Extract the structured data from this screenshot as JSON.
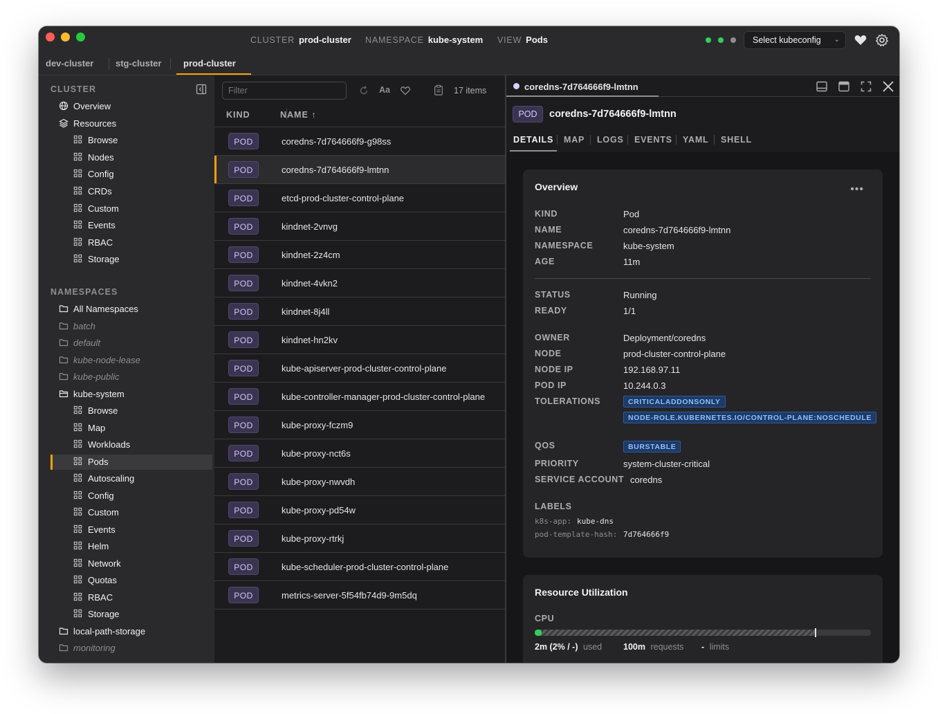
{
  "titlebar": {
    "cluster_key": "CLUSTER",
    "cluster_val": "prod-cluster",
    "namespace_key": "NAMESPACE",
    "namespace_val": "kube-system",
    "view_key": "VIEW",
    "view_val": "Pods",
    "status_dots": [
      "#30d158",
      "#30d158",
      "#8e8e93"
    ],
    "kubeconfig_label": "Select kubeconfig",
    "icons": [
      "heart-icon",
      "gear-icon"
    ]
  },
  "cluster_tabs": [
    "dev-cluster",
    "stg-cluster",
    "prod-cluster"
  ],
  "sidebar": {
    "cluster_header": "CLUSTER",
    "cluster_items": [
      {
        "label": "Overview",
        "icon": "globe-icon",
        "level": 0
      },
      {
        "label": "Resources",
        "icon": "layers-icon",
        "level": 0
      },
      {
        "label": "Browse",
        "icon": "grid-icon",
        "level": 1
      },
      {
        "label": "Nodes",
        "icon": "grid-icon",
        "level": 1
      },
      {
        "label": "Config",
        "icon": "grid-icon",
        "level": 1
      },
      {
        "label": "CRDs",
        "icon": "grid-icon",
        "level": 1
      },
      {
        "label": "Custom",
        "icon": "grid-icon",
        "level": 1
      },
      {
        "label": "Events",
        "icon": "grid-icon",
        "level": 1
      },
      {
        "label": "RBAC",
        "icon": "grid-icon",
        "level": 1
      },
      {
        "label": "Storage",
        "icon": "grid-icon",
        "level": 1
      }
    ],
    "namespaces_header": "NAMESPACES",
    "namespace_items": [
      {
        "label": "All Namespaces",
        "icon": "folder-icon",
        "level": 0
      },
      {
        "label": "batch",
        "icon": "folder-icon",
        "level": 0,
        "muted": true
      },
      {
        "label": "default",
        "icon": "folder-icon",
        "level": 0,
        "muted": true
      },
      {
        "label": "kube-node-lease",
        "icon": "folder-icon",
        "level": 0,
        "muted": true
      },
      {
        "label": "kube-public",
        "icon": "folder-icon",
        "level": 0,
        "muted": true
      },
      {
        "label": "kube-system",
        "icon": "folder-open-icon",
        "level": 0
      },
      {
        "label": "Browse",
        "icon": "grid-icon",
        "level": 1
      },
      {
        "label": "Map",
        "icon": "grid-icon",
        "level": 1
      },
      {
        "label": "Workloads",
        "icon": "grid-icon",
        "level": 1
      },
      {
        "label": "Pods",
        "icon": "grid-icon",
        "level": 1,
        "active": true
      },
      {
        "label": "Autoscaling",
        "icon": "grid-icon",
        "level": 1
      },
      {
        "label": "Config",
        "icon": "grid-icon",
        "level": 1
      },
      {
        "label": "Custom",
        "icon": "grid-icon",
        "level": 1
      },
      {
        "label": "Events",
        "icon": "grid-icon",
        "level": 1
      },
      {
        "label": "Helm",
        "icon": "grid-icon",
        "level": 1
      },
      {
        "label": "Network",
        "icon": "grid-icon",
        "level": 1
      },
      {
        "label": "Quotas",
        "icon": "grid-icon",
        "level": 1
      },
      {
        "label": "RBAC",
        "icon": "grid-icon",
        "level": 1
      },
      {
        "label": "Storage",
        "icon": "grid-icon",
        "level": 1
      },
      {
        "label": "local-path-storage",
        "icon": "folder-icon",
        "level": 0
      },
      {
        "label": "monitoring",
        "icon": "folder-icon",
        "level": 0,
        "muted": true
      }
    ]
  },
  "list": {
    "filter_placeholder": "Filter",
    "items_count": "17 items",
    "col_kind": "KIND",
    "col_name": "NAME ↑",
    "kind_badge": "POD",
    "rows": [
      "coredns-7d764666f9-g98ss",
      "coredns-7d764666f9-lmtnn",
      "etcd-prod-cluster-control-plane",
      "kindnet-2vnvg",
      "kindnet-2z4cm",
      "kindnet-4vkn2",
      "kindnet-8j4ll",
      "kindnet-hn2kv",
      "kube-apiserver-prod-cluster-control-plane",
      "kube-controller-manager-prod-cluster-control-plane",
      "kube-proxy-fczm9",
      "kube-proxy-nct6s",
      "kube-proxy-nwvdh",
      "kube-proxy-pd54w",
      "kube-proxy-rtrkj",
      "kube-scheduler-prod-cluster-control-plane",
      "metrics-server-5f54fb74d9-9m5dq"
    ],
    "selected_index": 1
  },
  "detail": {
    "tab_title": "coredns-7d764666f9-lmtnn",
    "badge": "POD",
    "title": "coredns-7d764666f9-lmtnn",
    "subtabs": [
      "DETAILS",
      "MAP",
      "LOGS",
      "EVENTS",
      "YAML",
      "SHELL"
    ],
    "overview": {
      "title": "Overview",
      "menu": "•••",
      "kind_k": "KIND",
      "kind_v": "Pod",
      "name_k": "NAME",
      "name_v": "coredns-7d764666f9-lmtnn",
      "ns_k": "NAMESPACE",
      "ns_v": "kube-system",
      "age_k": "AGE",
      "age_v": "11m",
      "status_k": "STATUS",
      "status_v": "Running",
      "ready_k": "READY",
      "ready_v": "1/1",
      "owner_k": "OWNER",
      "owner_v": "Deployment/coredns",
      "node_k": "NODE",
      "node_v": "prod-cluster-control-plane",
      "nodeip_k": "NODE IP",
      "nodeip_v": "192.168.97.11",
      "podip_k": "POD IP",
      "podip_v": "10.244.0.3",
      "tol_k": "TOLERATIONS",
      "tol_1": "CRITICALADDONSONLY",
      "tol_2": "NODE-ROLE.KUBERNETES.IO/CONTROL-PLANE:NOSCHEDULE",
      "qos_k": "QOS",
      "qos_v": "BURSTABLE",
      "prio_k": "PRIORITY",
      "prio_v": "system-cluster-critical",
      "sa_k": "SERVICE ACCOUNT",
      "sa_v": "coredns",
      "labels_k": "LABELS",
      "label1_k": "k8s-app:",
      "label1_v": "kube-dns",
      "label2_k": "pod-template-hash:",
      "label2_v": "7d764666f9"
    },
    "resources": {
      "title": "Resource Utilization",
      "cpu_k": "CPU",
      "cpu_used_fraction": 0.02,
      "cpu_used": "2m (2% / -)",
      "cpu_used_lbl": "used",
      "cpu_req": "100m",
      "cpu_req_lbl": "requests",
      "cpu_lim": "-",
      "cpu_lim_lbl": "limits"
    }
  }
}
